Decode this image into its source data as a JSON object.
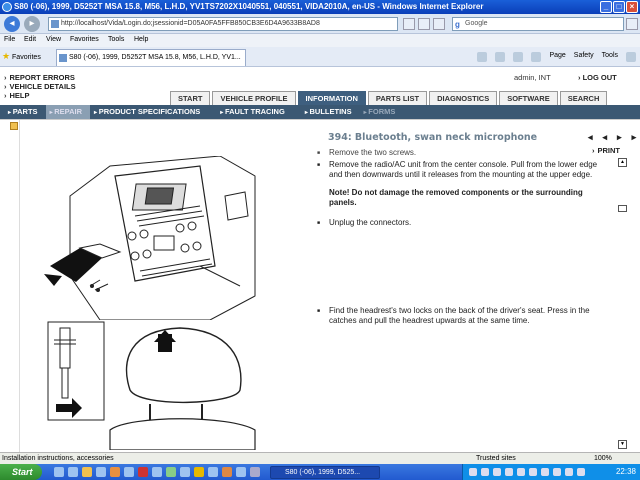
{
  "window": {
    "title": "S80 (-06), 1999, D5252T MSA 15.8, M56, L.H.D, YV1TS7202X1040551, 040551, VIDA2010A, en-US - Windows Internet Explorer",
    "url": "http://localhost/Vida/Login.do;jsessionid=D05A0FA5FFB850CB3E6D4A9633B8AD8",
    "search_placeholder": "Google"
  },
  "menu": {
    "items": [
      "File",
      "Edit",
      "View",
      "Favorites",
      "Tools",
      "Help"
    ]
  },
  "favorites": {
    "label": "Favorites",
    "tab_title": "S80 (-06), 1999, D5252T MSA 15.8, M56, L.H.D, YV1...",
    "page_label": "Page",
    "safety_label": "Safety",
    "tools_label": "Tools"
  },
  "header": {
    "links": [
      "REPORT ERRORS",
      "VEHICLE DETAILS",
      "HELP"
    ],
    "user": "admin, INT",
    "logout": "LOG OUT"
  },
  "tabs": [
    "START",
    "VEHICLE PROFILE",
    "INFORMATION",
    "PARTS LIST",
    "DIAGNOSTICS",
    "SOFTWARE",
    "SEARCH"
  ],
  "active_tab": "INFORMATION",
  "subnav": [
    "PARTS",
    "REPAIR",
    "PRODUCT SPECIFICATIONS",
    "FAULT TRACING",
    "BULLETINS",
    "FORMS"
  ],
  "active_subnav": "REPAIR",
  "document": {
    "title": "394: Bluetooth, swan neck microphone",
    "print_label": "PRINT",
    "nav_prev": "◂◂",
    "nav_next": "▸▸",
    "steps": [
      "Remove the two screws.",
      "Remove the radio/AC unit from the center console. Pull from the lower edge and then downwards until it releases from the mounting at the upper edge."
    ],
    "note": "Note! Do not damage the removed components or the surrounding panels.",
    "step3": "Unplug the connectors.",
    "step4": "Find the headrest's two locks on the back of the driver's seat. Press in the catches and pull the headrest upwards at the same time."
  },
  "statusbar": {
    "text": "Installation instructions, accessories",
    "zone": "Trusted sites",
    "zoom": "100%"
  },
  "taskbar": {
    "start": "Start",
    "task": "S80 (-06), 1999, D525...",
    "clock": "22:38"
  }
}
